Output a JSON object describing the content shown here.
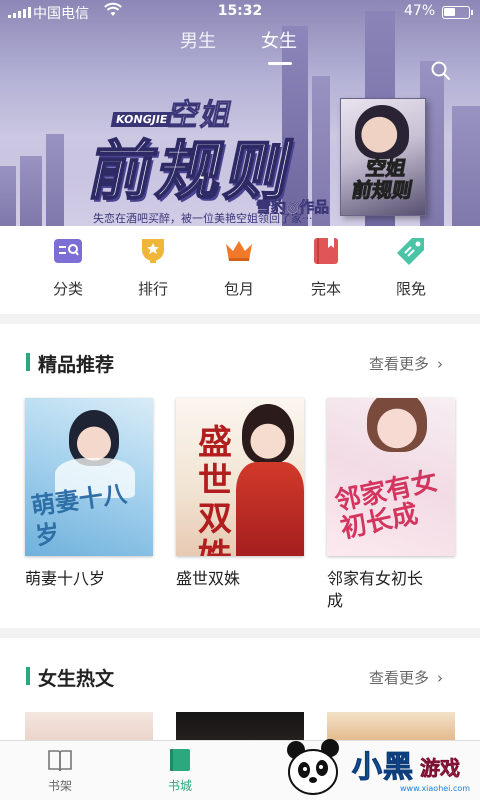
{
  "status_bar": {
    "carrier": "中国电信",
    "time": "15:32",
    "battery": "47%",
    "battery_level": 0.47
  },
  "top_tabs": {
    "tabs": [
      {
        "label": "男生",
        "active": false
      },
      {
        "label": "女生",
        "active": true
      }
    ]
  },
  "banner": {
    "pinyin": "KONGJIE",
    "title_top": "空姐",
    "title_main": "前规则",
    "author": "雪豹◎作品",
    "tagline": "失恋在酒吧买醉，被一位美艳空姐领回了家···",
    "book_title": "前规则",
    "book_title_top": "空姐"
  },
  "categories": [
    {
      "label": "分类",
      "icon": "category-icon",
      "color": "#7b6fd6"
    },
    {
      "label": "排行",
      "icon": "ranking-trophy-icon",
      "color": "#f0b63a"
    },
    {
      "label": "包月",
      "icon": "crown-icon",
      "color": "#f07a2a"
    },
    {
      "label": "完本",
      "icon": "book-icon",
      "color": "#e05656"
    },
    {
      "label": "限免",
      "icon": "tag-icon",
      "color": "#4bc4a6"
    }
  ],
  "sections": [
    {
      "title": "精品推荐",
      "more": "查看更多",
      "books": [
        {
          "title": "萌妻十八岁",
          "cover_text": "萌妻十八岁"
        },
        {
          "title": "盛世双姝",
          "cover_text": "盛世双姝"
        },
        {
          "title": "邻家有女初长成",
          "cover_text": "邻家有女初长成"
        }
      ]
    },
    {
      "title": "女生热文",
      "more": "查看更多"
    }
  ],
  "bottom_nav": [
    {
      "label": "书架",
      "icon": "bookshelf-icon",
      "active": false
    },
    {
      "label": "书城",
      "icon": "bookstore-icon",
      "active": true
    }
  ],
  "watermark": {
    "brand": "小黑",
    "brand2": "游戏",
    "url": "www.xiaohei.com"
  },
  "colors": {
    "accent": "#2aa87e"
  }
}
